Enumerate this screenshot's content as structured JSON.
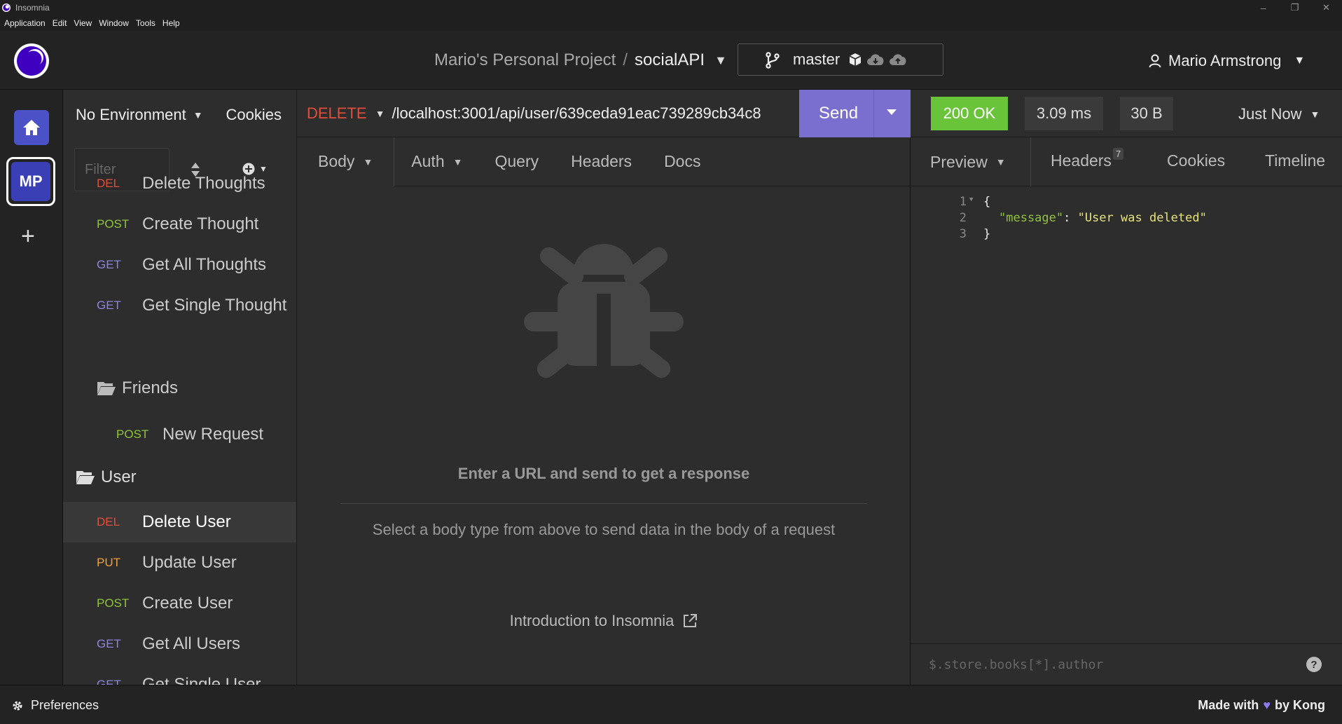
{
  "window": {
    "title": "Insomnia",
    "controls": [
      "–",
      "❐",
      "✕"
    ]
  },
  "menu": [
    "Application",
    "Edit",
    "View",
    "Window",
    "Tools",
    "Help"
  ],
  "header": {
    "project": "Mario's Personal Project",
    "separator": "/",
    "collection": "socialAPI",
    "branch": "master",
    "user": "Mario Armstrong"
  },
  "rail": {
    "workspace_initials": "MP"
  },
  "sidebar": {
    "environment": "No Environment",
    "cookies": "Cookies",
    "filter_placeholder": "Filter",
    "items": [
      {
        "method": "DEL",
        "name": "Delete Thoughts"
      },
      {
        "method": "POST",
        "name": "Create Thought"
      },
      {
        "method": "GET",
        "name": "Get All Thoughts"
      },
      {
        "method": "GET",
        "name": "Get Single Thought"
      }
    ],
    "friends_folder": "Friends",
    "friends_item": {
      "method": "POST",
      "name": "New Request"
    },
    "user_folder": "User",
    "user_items": [
      {
        "method": "DEL",
        "name": "Delete User"
      },
      {
        "method": "PUT",
        "name": "Update User"
      },
      {
        "method": "POST",
        "name": "Create User"
      },
      {
        "method": "GET",
        "name": "Get All Users"
      },
      {
        "method": "GET",
        "name": "Get Single User"
      }
    ]
  },
  "request": {
    "method": "DELETE",
    "url": "/localhost:3001/api/user/639ceda91eac739289cb34c8",
    "send": "Send",
    "tabs": [
      "Body",
      "Auth",
      "Query",
      "Headers",
      "Docs"
    ],
    "empty_title": "Enter a URL and send to get a response",
    "empty_body": "Select a body type from above to send data in the body of a request",
    "intro_link": "Introduction to Insomnia"
  },
  "response": {
    "status": "200 OK",
    "time": "3.09 ms",
    "size": "30 B",
    "when": "Just Now",
    "tabs": [
      "Preview",
      "Headers",
      "Cookies",
      "Timeline"
    ],
    "headers_count": "7",
    "code_lines": [
      "1",
      "2",
      "3"
    ],
    "code": {
      "open": "{",
      "key": "\"message\"",
      "colon": ": ",
      "value": "\"User was deleted\"",
      "close": "}"
    },
    "filter_placeholder": "$.store.books[*].author",
    "help": "?"
  },
  "footer": {
    "preferences": "Preferences",
    "made_with": "Made with",
    "by": "by Kong"
  },
  "colors": {
    "accent": "#7a6fcf",
    "ok": "#6ac43a",
    "del": "#e04e3c",
    "post": "#8fc43a",
    "get": "#8b85e0",
    "put": "#f0a03a"
  }
}
